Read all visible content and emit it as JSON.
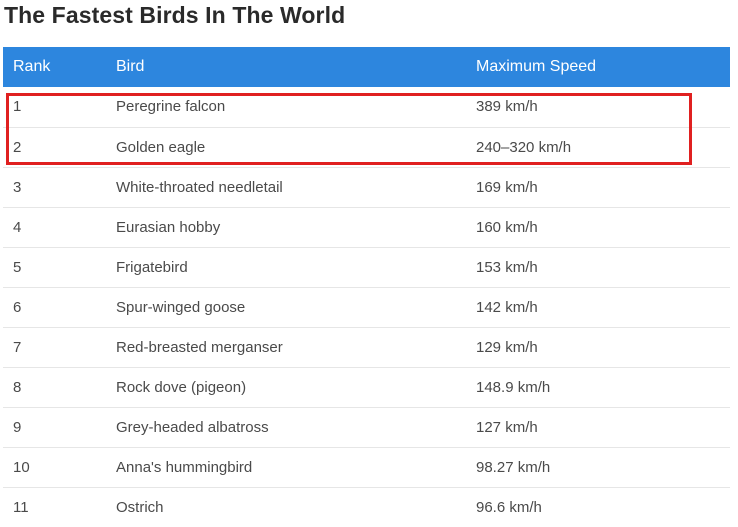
{
  "title": "The Fastest Birds In The World",
  "table": {
    "headers": [
      "Rank",
      "Bird",
      "Maximum Speed"
    ],
    "rows": [
      {
        "rank": "1",
        "bird": "Peregrine falcon",
        "speed": "389 km/h"
      },
      {
        "rank": "2",
        "bird": "Golden eagle",
        "speed": "240–320 km/h"
      },
      {
        "rank": "3",
        "bird": "White-throated needletail",
        "speed": "169 km/h"
      },
      {
        "rank": "4",
        "bird": "Eurasian hobby",
        "speed": "160 km/h"
      },
      {
        "rank": "5",
        "bird": "Frigatebird",
        "speed": "153 km/h"
      },
      {
        "rank": "6",
        "bird": "Spur-winged goose",
        "speed": "142 km/h"
      },
      {
        "rank": "7",
        "bird": "Red-breasted merganser",
        "speed": "129 km/h"
      },
      {
        "rank": "8",
        "bird": "Rock dove (pigeon)",
        "speed": "148.9 km/h"
      },
      {
        "rank": "9",
        "bird": "Grey-headed albatross",
        "speed": "127 km/h"
      },
      {
        "rank": "10",
        "bird": "Anna's hummingbird",
        "speed": "98.27 km/h"
      },
      {
        "rank": "11",
        "bird": "Ostrich",
        "speed": "96.6 km/h"
      }
    ]
  },
  "colors": {
    "header_bg": "#2d86de",
    "highlight": "#e02020"
  }
}
